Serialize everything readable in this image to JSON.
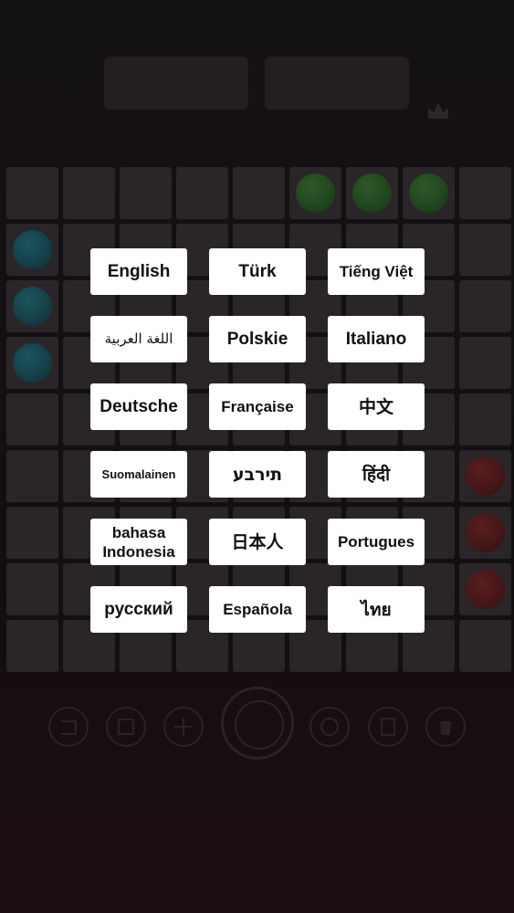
{
  "languages": [
    {
      "label": "English",
      "slug": "english"
    },
    {
      "label": "Türk",
      "slug": "turkish"
    },
    {
      "label": "Tiếng Việt",
      "slug": "vietnamese"
    },
    {
      "label": "اللغة العربية",
      "slug": "arabic"
    },
    {
      "label": "Polskie",
      "slug": "polish"
    },
    {
      "label": "Italiano",
      "slug": "italian"
    },
    {
      "label": "Deutsche",
      "slug": "german"
    },
    {
      "label": "Française",
      "slug": "french"
    },
    {
      "label": "中文",
      "slug": "chinese"
    },
    {
      "label": "Suomalainen",
      "slug": "finnish"
    },
    {
      "label": "תירבע",
      "slug": "hebrew"
    },
    {
      "label": "हिंदी",
      "slug": "hindi"
    },
    {
      "label": "bahasa Indonesia",
      "slug": "indonesian"
    },
    {
      "label": "日本人",
      "slug": "japanese"
    },
    {
      "label": "Portugues",
      "slug": "portuguese"
    },
    {
      "label": "русский",
      "slug": "russian"
    },
    {
      "label": "Española",
      "slug": "spanish"
    },
    {
      "label": "ไทย",
      "slug": "thai"
    }
  ],
  "colors": {
    "button_bg": "#ffffff",
    "button_text": "#111111",
    "overlay_bg": "#141114",
    "ball_green": "#2e5a2a",
    "ball_teal": "#1c5560",
    "ball_red": "#5a1e22"
  },
  "icons": {
    "toolbar": [
      "undo-icon",
      "calendar-icon",
      "plus-icon",
      "center-dial-icon",
      "clock-icon",
      "copy-icon",
      "trash-icon"
    ],
    "header": "crown-icon"
  }
}
